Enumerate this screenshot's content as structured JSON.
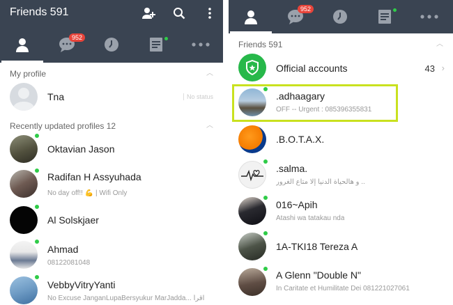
{
  "left": {
    "title": "Friends 591",
    "chat_badge": "952",
    "my_profile_header": "My profile",
    "my_profile": {
      "name": "Tna",
      "hint": "No status"
    },
    "recent_header": "Recently updated profiles 12",
    "friends": [
      {
        "name": "Oktavian Jason",
        "status": ""
      },
      {
        "name": "Radifan H Assyuhada",
        "status": "No day off!! 💪 | Wifi Only"
      },
      {
        "name": "Al Solskjaer",
        "status": ""
      },
      {
        "name": "Ahmad",
        "status": "08122081048"
      },
      {
        "name": "VebbyVitryYanti",
        "status": "No Excuse JanganLupaBersyukur MarJadda... اقرأ"
      }
    ]
  },
  "right": {
    "chat_badge": "952",
    "friends_header": "Friends 591",
    "official": {
      "name": "Official accounts",
      "count": "43"
    },
    "friends": [
      {
        "name": ".adhaagary",
        "status": "OFF -- Urgent : 085396355831"
      },
      {
        "name": ".B.O.T.A.X.",
        "status": ""
      },
      {
        "name": ".salma.",
        "status": "و هالحياة الدنيا إلا متاع الغرور .."
      },
      {
        "name": "016~Apih",
        "status": "Atashi wa tatakau nda"
      },
      {
        "name": "1A-TKI18 Tereza A",
        "status": ""
      },
      {
        "name": "A Glenn \"Double N\"",
        "status": "In Caritate et Humilitate Dei 081221027061"
      }
    ]
  },
  "colors": {
    "bar": "#3a4452",
    "accent_green": "#2fcc48",
    "badge_red": "#e8443a",
    "highlight": "#c9e11f"
  },
  "icons": [
    "person-icon",
    "add-friend-icon",
    "search-icon",
    "more-vert-icon",
    "chat-icon",
    "clock-icon",
    "timeline-icon",
    "more-horiz-icon",
    "shield-icon",
    "chevron-right-icon"
  ]
}
